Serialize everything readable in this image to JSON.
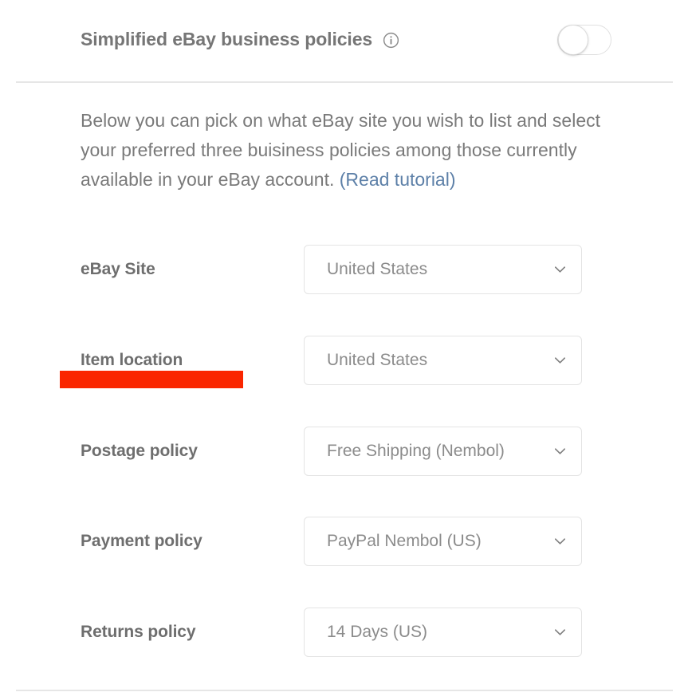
{
  "header": {
    "title": "Simplified eBay business policies",
    "info_icon": "info-circle-icon",
    "toggle": {
      "name": "simplified-policies-toggle",
      "state": "off"
    }
  },
  "description": {
    "text_before_link": "Below you can pick on what eBay site you wish to list and select your preferred three buisiness policies among those currently available in your eBay account. ",
    "link_label": "(Read tutorial)"
  },
  "form": {
    "rows": [
      {
        "label": "eBay Site",
        "name": "ebay-site",
        "value": "United States",
        "chevron": "chevron-down-icon"
      },
      {
        "label": "Item location",
        "name": "item-location",
        "value": "United States",
        "chevron": "chevron-down-icon"
      },
      {
        "label": "Postage policy",
        "name": "postage-policy",
        "value": "Free Shipping (Nembol)",
        "chevron": "chevron-down-icon"
      },
      {
        "label": "Payment policy",
        "name": "payment-policy",
        "value": "PayPal Nembol (US)",
        "chevron": "chevron-down-icon"
      },
      {
        "label": "Returns policy",
        "name": "returns-policy",
        "value": "14 Days (US)",
        "chevron": "chevron-down-icon"
      }
    ]
  },
  "annotation": {
    "name": "item-location-highlight",
    "color": "#fa2600"
  },
  "colors": {
    "label_text": "#6e6e6e",
    "value_text": "#8b8b8b",
    "body_text": "#7a7a7a",
    "link": "#5d80a8",
    "border": "#e4e4e4",
    "divider": "#e6e6e6",
    "highlight_red": "#fa2600"
  }
}
